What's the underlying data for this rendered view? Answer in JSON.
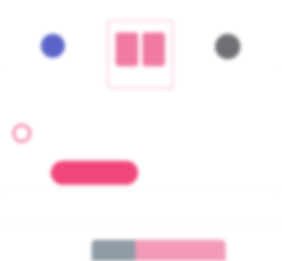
{
  "top": {
    "caption": ""
  },
  "themes": [
    {
      "label": "",
      "color": "#5b63c9",
      "icon": "blue-circle-icon"
    },
    {
      "label": "",
      "color": "#f07aa2",
      "icon": "pink-pattern-icon",
      "selected": true
    },
    {
      "label": "",
      "color": "#6f6f75",
      "icon": "gray-circle-icon"
    }
  ],
  "tabs": {
    "icon": "pink-ring-icon",
    "items": [
      "",
      "",
      "",
      ""
    ]
  },
  "grid": {
    "rows": [
      {
        "pill": "",
        "cells": [
          "",
          "",
          ""
        ]
      },
      {
        "cells": [
          "",
          "",
          "",
          ""
        ]
      }
    ]
  },
  "colors": {
    "accent": "#f0467a",
    "pill_text": "#ffffff"
  }
}
